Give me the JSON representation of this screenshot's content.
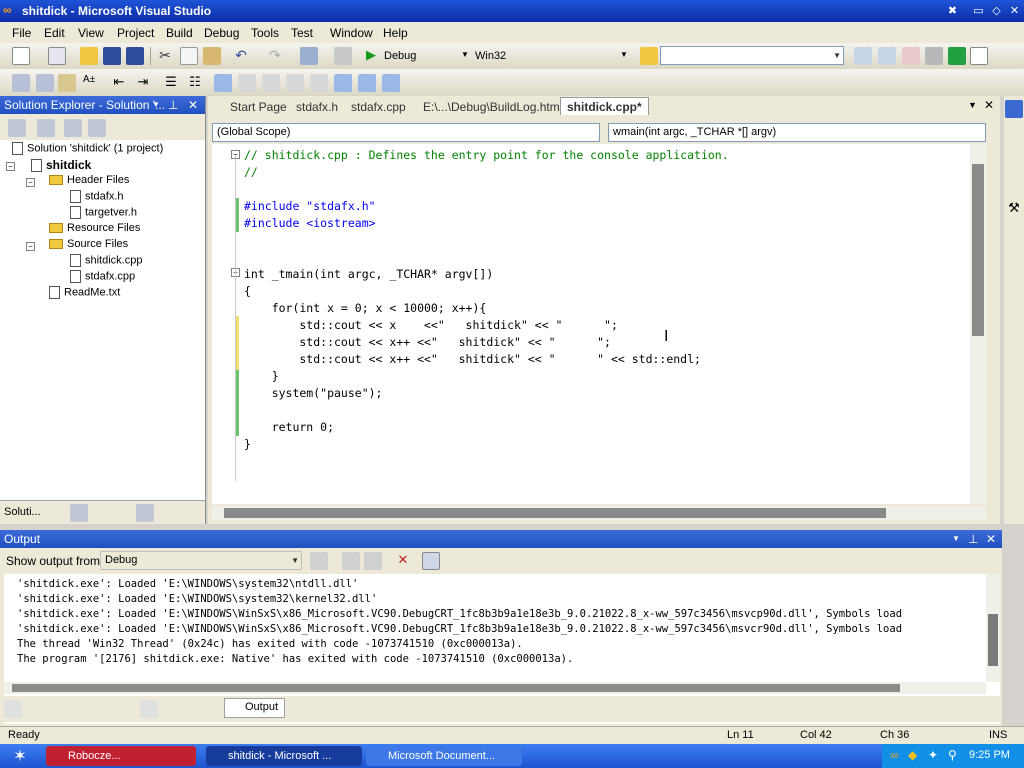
{
  "window": {
    "title": "shitdick - Microsoft Visual Studio"
  },
  "menu": [
    "File",
    "Edit",
    "View",
    "Project",
    "Build",
    "Debug",
    "Tools",
    "Test",
    "Window",
    "Help"
  ],
  "toolbar": {
    "config": "Debug",
    "platform": "Win32"
  },
  "solution_explorer": {
    "title": "Solution Explorer - Solution '...",
    "items": [
      {
        "label": "Solution 'shitdick' (1 project)"
      },
      {
        "label": "shitdick"
      },
      {
        "label": "Header Files"
      },
      {
        "label": "stdafx.h"
      },
      {
        "label": "targetver.h"
      },
      {
        "label": "Resource Files"
      },
      {
        "label": "Source Files"
      },
      {
        "label": "shitdick.cpp"
      },
      {
        "label": "stdafx.cpp"
      },
      {
        "label": "ReadMe.txt"
      }
    ],
    "bottom_tab": "Soluti..."
  },
  "editor": {
    "tabs": [
      "Start Page",
      "stdafx.h",
      "stdafx.cpp",
      "E:\\...\\Debug\\BuildLog.htm",
      "shitdick.cpp*"
    ],
    "scope": "(Global Scope)",
    "function": "wmain(int argc, _TCHAR *[] argv)",
    "lines": [
      "// shitdick.cpp : Defines the entry point for the console application.",
      "//",
      "",
      "#include \"stdafx.h\"",
      "#include <iostream>",
      "",
      "",
      "int _tmain(int argc, _TCHAR* argv[])",
      "{",
      "    for(int x = 0; x < 10000; x++){",
      "        std::cout << x    <<\"   shitdick\" << \"      \";",
      "        std::cout << x++ <<\"   shitdick\" << \"      \";",
      "        std::cout << x++ <<\"   shitdick\" << \"      \" << std::endl;",
      "    }",
      "    system(\"pause\");",
      "",
      "    return 0;",
      "}"
    ]
  },
  "output": {
    "title": "Output",
    "show_from_label": "Show output from:",
    "source": "Debug",
    "lines": [
      "'shitdick.exe': Loaded 'E:\\WINDOWS\\system32\\ntdll.dll'",
      "'shitdick.exe': Loaded 'E:\\WINDOWS\\system32\\kernel32.dll'",
      "'shitdick.exe': Loaded 'E:\\WINDOWS\\WinSxS\\x86_Microsoft.VC90.DebugCRT_1fc8b3b9a1e18e3b_9.0.21022.8_x-ww_597c3456\\msvcp90d.dll', Symbols load",
      "'shitdick.exe': Loaded 'E:\\WINDOWS\\WinSxS\\x86_Microsoft.VC90.DebugCRT_1fc8b3b9a1e18e3b_9.0.21022.8_x-ww_597c3456\\msvcr90d.dll', Symbols load",
      "The thread 'Win32 Thread' (0x24c) has exited with code -1073741510 (0xc000013a).",
      "The program '[2176] shitdick.exe: Native' has exited with code -1073741510 (0xc000013a)."
    ],
    "tab": "Output"
  },
  "status": {
    "ready": "Ready",
    "ln": "Ln 11",
    "col": "Col 42",
    "ch": "Ch 36",
    "ins": "INS"
  },
  "taskbar": {
    "tasks": [
      "Robocze...",
      "shitdick - Microsoft ...",
      "Microsoft Document..."
    ],
    "clock": "9:25 PM"
  },
  "colors": {
    "keyword": "#0000ff",
    "comment": "#008000",
    "string": "#a31515",
    "taskbar": "#2456d6"
  }
}
